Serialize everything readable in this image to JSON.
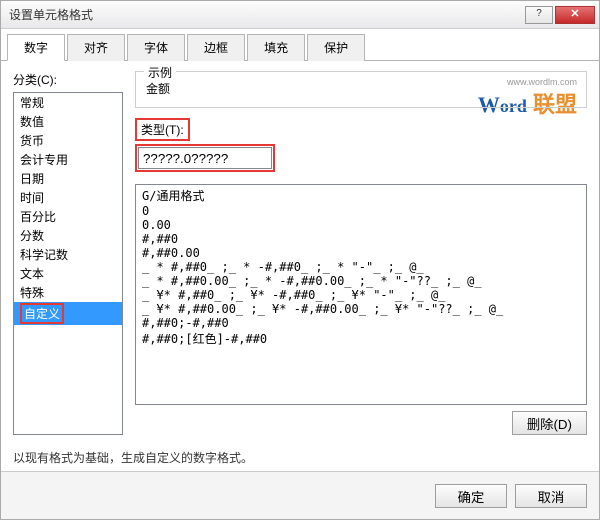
{
  "window": {
    "title": "设置单元格格式"
  },
  "tabs": [
    "数字",
    "对齐",
    "字体",
    "边框",
    "填充",
    "保护"
  ],
  "activeTab": 0,
  "category": {
    "label": "分类(C):",
    "items": [
      "常规",
      "数值",
      "货币",
      "会计专用",
      "日期",
      "时间",
      "百分比",
      "分数",
      "科学记数",
      "文本",
      "特殊",
      "自定义"
    ],
    "selected": "自定义"
  },
  "example": {
    "legend": "示例",
    "value": "金额"
  },
  "type": {
    "label": "类型(T):",
    "value": "?????.0?????"
  },
  "formats": [
    "G/通用格式",
    "0",
    "0.00",
    "#,##0",
    "#,##0.00",
    "_ * #,##0_ ;_ * -#,##0_ ;_ * \"-\"_ ;_ @_ ",
    "_ * #,##0.00_ ;_ * -#,##0.00_ ;_ * \"-\"??_ ;_ @_ ",
    "_ ¥* #,##0_ ;_ ¥* -#,##0_ ;_ ¥* \"-\"_ ;_ @_ ",
    "_ ¥* #,##0.00_ ;_ ¥* -#,##0.00_ ;_ ¥* \"-\"??_ ;_ @_ ",
    "#,##0;-#,##0",
    "#,##0;[红色]-#,##0"
  ],
  "deleteBtn": "删除(D)",
  "hint": "以现有格式为基础，生成自定义的数字格式。",
  "footer": {
    "ok": "确定",
    "cancel": "取消"
  },
  "watermark": {
    "url": "www.wordlm.com",
    "cn": "联盟"
  }
}
